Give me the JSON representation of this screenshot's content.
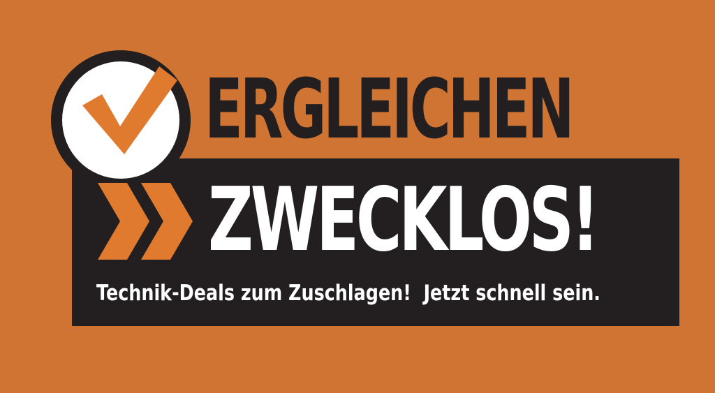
{
  "headline": {
    "line1": "ERGLEICHEN",
    "line2": "ZWECKLOS!"
  },
  "tagline": "Technik-Deals zum Zuschlagen!  Jetzt schnell sein.",
  "icons": {
    "badge": "check-circle-icon",
    "arrows": "double-chevron-right-icon"
  },
  "colors": {
    "background": "#cf7433",
    "accent": "#e07a2e",
    "dark": "#231f20",
    "light": "#ffffff"
  }
}
